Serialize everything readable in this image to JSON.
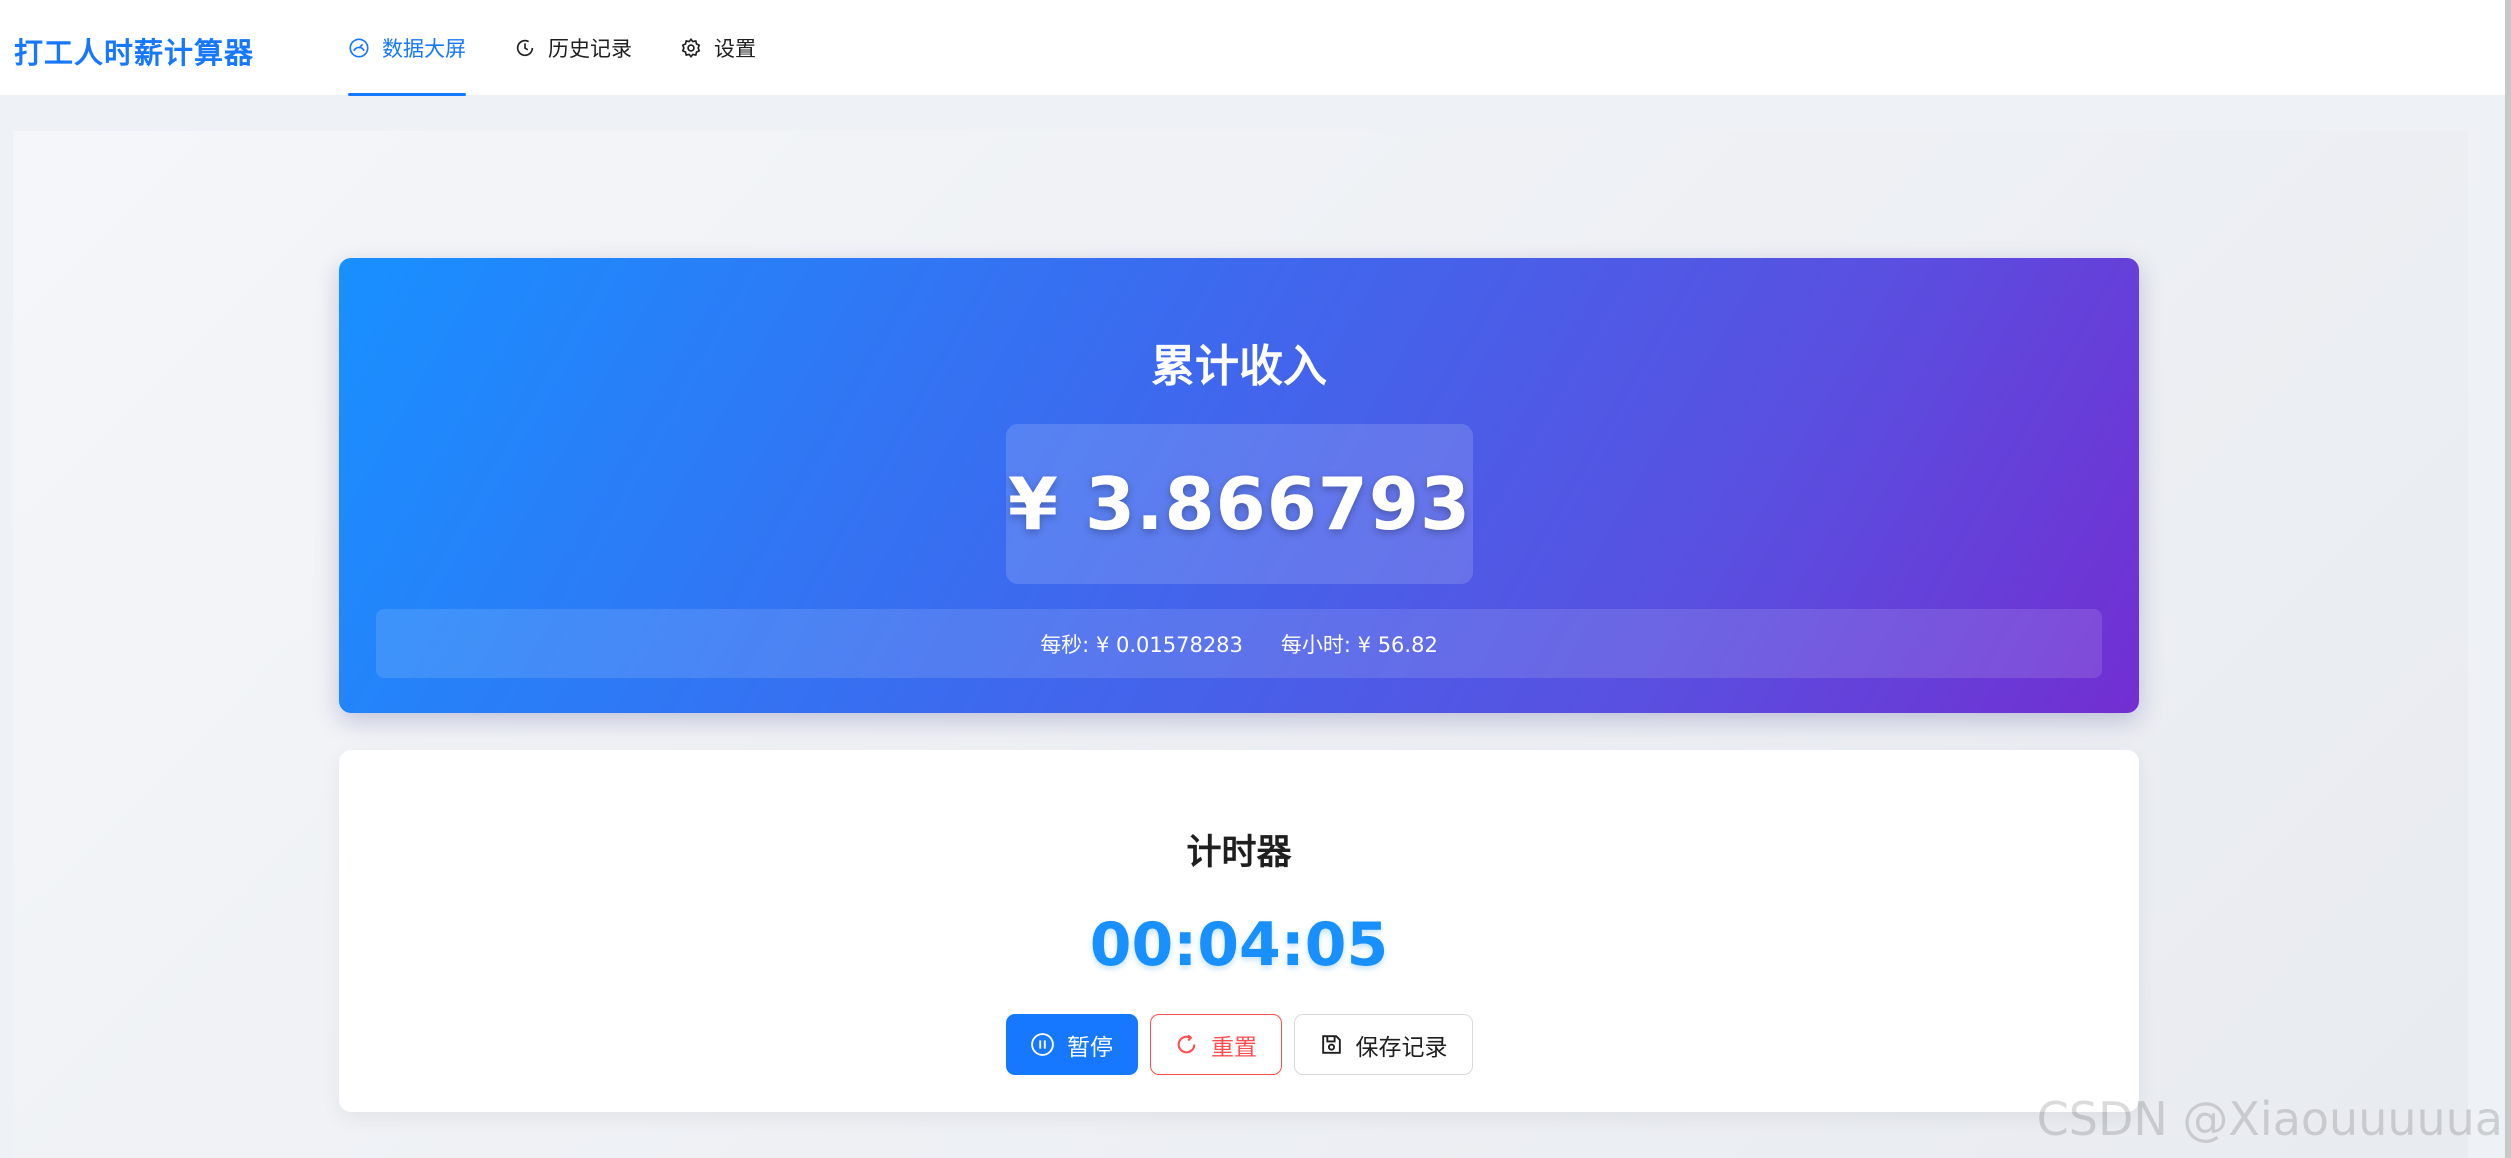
{
  "header": {
    "brand": "打工人时薪计算器",
    "nav": [
      {
        "label": "数据大屏",
        "icon": "dashboard-icon",
        "active": true
      },
      {
        "label": "历史记录",
        "icon": "history-clock-icon",
        "active": false
      },
      {
        "label": "设置",
        "icon": "gear-icon",
        "active": false
      }
    ]
  },
  "income": {
    "title": "累计收入",
    "amount": "¥ 3.866793",
    "per_second": "每秒: ¥ 0.01578283",
    "per_hour": "每小时: ¥ 56.82"
  },
  "timer": {
    "title": "计时器",
    "value": "00:04:05",
    "pause_label": "暂停",
    "reset_label": "重置",
    "save_label": "保存记录"
  },
  "watermark": "CSDN @Xiaouuuuua",
  "colors": {
    "primary": "#1677ff",
    "danger": "#ff4d4f",
    "gradient_start": "#1890ff",
    "gradient_end": "#722ed1"
  }
}
